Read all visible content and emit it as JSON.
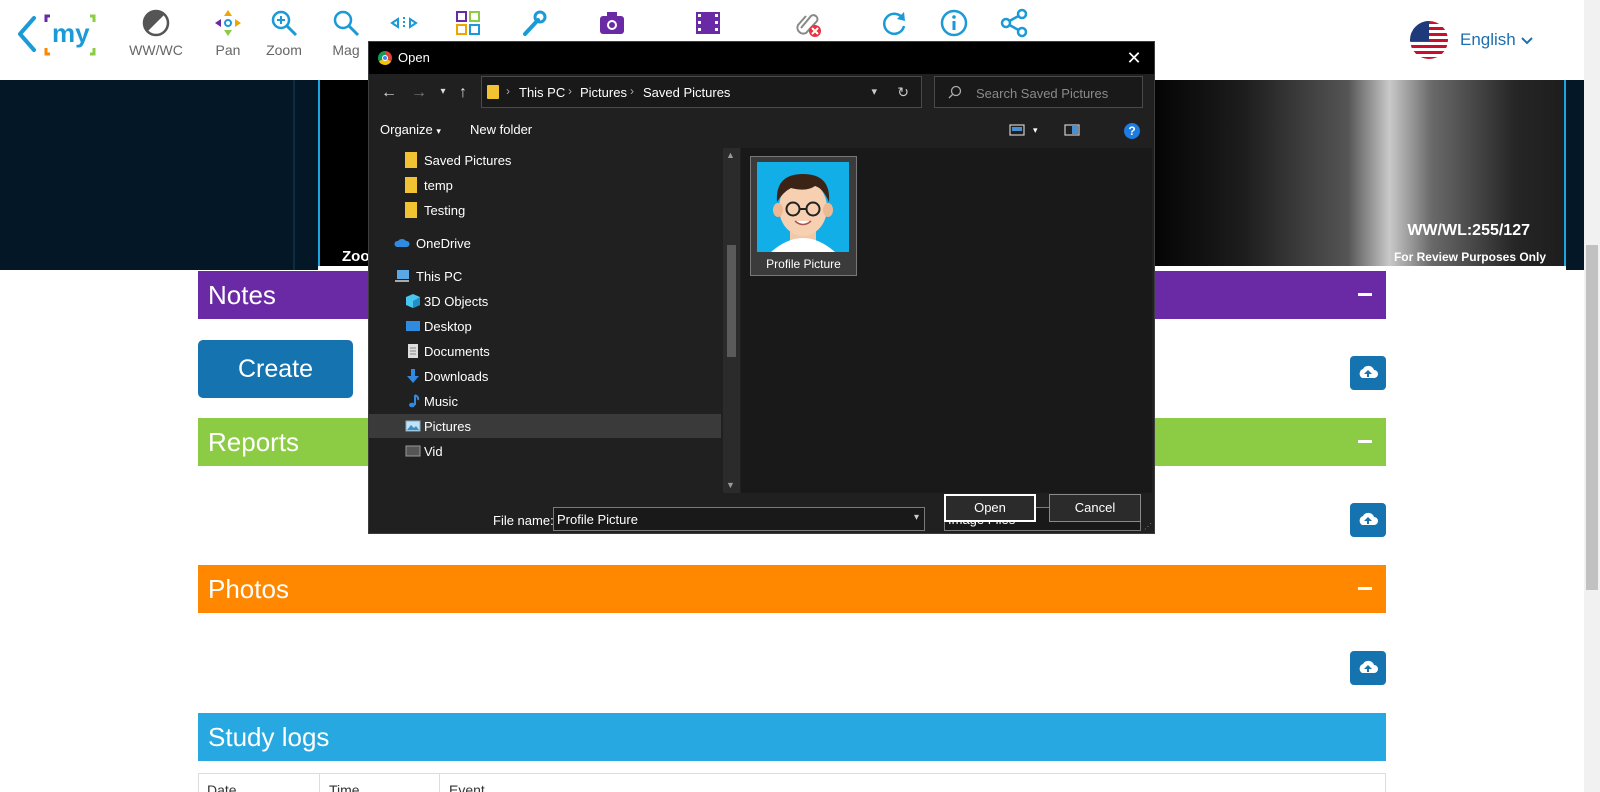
{
  "toolbar": {
    "tools": [
      {
        "label": "WW/WC",
        "icon": "contrast-icon"
      },
      {
        "label": "Pan",
        "icon": "pan-icon"
      },
      {
        "label": "Zoom",
        "icon": "zoom-icon"
      },
      {
        "label": "Mag",
        "icon": "magnify-icon"
      },
      {
        "label": "",
        "icon": "measure-icon"
      },
      {
        "label": "",
        "icon": "grid-layout-icon"
      },
      {
        "label": "",
        "icon": "wrench-icon"
      },
      {
        "label": "",
        "icon": "camera-icon"
      },
      {
        "label": "",
        "icon": "film-icon"
      },
      {
        "label": "",
        "icon": "detach-icon"
      },
      {
        "label": "",
        "icon": "reset-icon"
      },
      {
        "label": "",
        "icon": "info-icon"
      },
      {
        "label": "",
        "icon": "share-icon"
      }
    ],
    "logo_text": "my",
    "language": "English"
  },
  "viewer": {
    "zoom_text": "Zoo",
    "wwwl": "WW/WL:255/127",
    "review_note": "For Review Purposes Only"
  },
  "sections": {
    "notes": "Notes",
    "reports": "Reports",
    "photos": "Photos",
    "study_logs": "Study logs"
  },
  "create_label": "Create",
  "log_columns": [
    "Date",
    "Time",
    "Event"
  ],
  "dialog": {
    "title": "Open",
    "breadcrumb": [
      "This PC",
      "Pictures",
      "Saved Pictures"
    ],
    "search_placeholder": "Search Saved Pictures",
    "organize": "Organize",
    "new_folder": "New folder",
    "nav_items": [
      {
        "label": "Saved Pictures",
        "icon": "folder-icon",
        "indent": 2
      },
      {
        "label": "temp",
        "icon": "folder-icon",
        "indent": 2
      },
      {
        "label": "Testing",
        "icon": "folder-icon",
        "indent": 2
      },
      {
        "label": "OneDrive",
        "icon": "cloud-icon",
        "indent": 1
      },
      {
        "label": "This PC",
        "icon": "computer-icon",
        "indent": 1
      },
      {
        "label": "3D Objects",
        "icon": "cube-icon",
        "indent": 2
      },
      {
        "label": "Desktop",
        "icon": "desktop-icon",
        "indent": 2
      },
      {
        "label": "Documents",
        "icon": "document-icon",
        "indent": 2
      },
      {
        "label": "Downloads",
        "icon": "download-icon",
        "indent": 2
      },
      {
        "label": "Music",
        "icon": "music-icon",
        "indent": 2
      },
      {
        "label": "Pictures",
        "icon": "pictures-icon",
        "indent": 2,
        "selected": true
      },
      {
        "label": "Vid",
        "icon": "video-icon",
        "indent": 2
      }
    ],
    "file": {
      "label": "Profile Picture",
      "icon": "avatar-thumbnail"
    },
    "filename_label": "File name:",
    "filename_value": "Profile Picture",
    "filetype": "Image Files",
    "open_label": "Open",
    "cancel_label": "Cancel"
  },
  "colors": {
    "notes": "#6a2aa5",
    "reports": "#8ccc44",
    "photos": "#ff8800",
    "study_logs": "#27a8e0",
    "button": "#1573b0"
  }
}
